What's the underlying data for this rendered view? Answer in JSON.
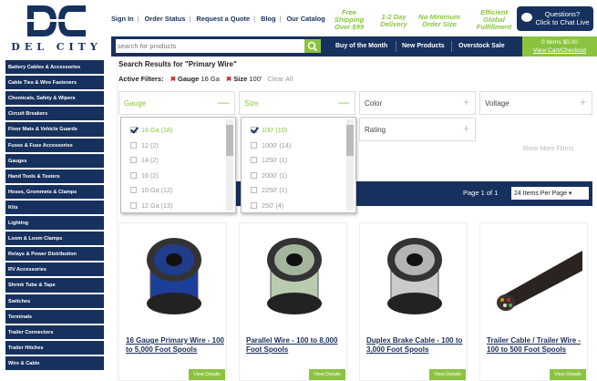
{
  "logo": {
    "word": "DEL CITY"
  },
  "top_links": [
    "Sign In",
    "Order Status",
    "Request a Quote",
    "Blog",
    "Our Catalog"
  ],
  "promos": [
    {
      "l1": "Free",
      "l2": "Shipping",
      "l3": "Over $99"
    },
    {
      "l1": "1-2 Day",
      "l2": "Delivery",
      "l3": ""
    },
    {
      "l1": "No Minimum",
      "l2": "Order Size",
      "l3": ""
    },
    {
      "l1": "Efficient",
      "l2": "Global",
      "l3": "Fulfillment"
    }
  ],
  "chat": {
    "l1": "Questions?",
    "l2": "Click to Chat Live"
  },
  "search": {
    "placeholder": "search for products"
  },
  "nav": [
    "Buy of the Month",
    "New Products",
    "Overstock Sale"
  ],
  "cart": {
    "l1": "0 Items    $0.00",
    "l2": "View Cart/Checkout"
  },
  "sidebar": [
    "Battery Cables & Accessories",
    "Cable Ties & Wire Fasteners",
    "Chemicals, Safety & Wipers",
    "Circuit Breakers",
    "Floor Mats & Vehicle Guards",
    "Fuses & Fuse Accessories",
    "Gauges",
    "Hand Tools & Testers",
    "Hoses, Grommets & Clamps",
    "Kits",
    "Lighting",
    "Loom & Loom Clamps",
    "Relays & Power Distribution",
    "RV Accessories",
    "Shrink Tube & Tape",
    "Switches",
    "Terminals",
    "Trailer Connectors",
    "Trailer Hitches",
    "Wire & Cable"
  ],
  "results": {
    "title": "Search Results for \"Primary Wire\"",
    "active_label": "Active Filters:",
    "f1_name": "Gauge",
    "f1_val": "16 Ga",
    "f2_name": "Size",
    "f2_val": "100'",
    "clear": "Clear All"
  },
  "filters": [
    {
      "label": "Gauge",
      "sign": "—"
    },
    {
      "label": "Size",
      "sign": "—"
    },
    {
      "label": "Color",
      "sign": "+"
    },
    {
      "label": "Voltage",
      "sign": "+"
    },
    {
      "label": "Rating",
      "sign": "+"
    }
  ],
  "gauge_opts": [
    {
      "t": "16 Ga (18)",
      "on": true
    },
    {
      "t": "12 (2)",
      "on": false
    },
    {
      "t": "14 (2)",
      "on": false
    },
    {
      "t": "16 (2)",
      "on": false
    },
    {
      "t": "10 Ga (12)",
      "on": false
    },
    {
      "t": "12 Ga (13)",
      "on": false
    }
  ],
  "size_opts": [
    {
      "t": "100' (10)",
      "on": true
    },
    {
      "t": "1000' (14)",
      "on": false
    },
    {
      "t": "1250' (1)",
      "on": false
    },
    {
      "t": "2000' (1)",
      "on": false
    },
    {
      "t": "2250' (1)",
      "on": false
    },
    {
      "t": "250' (4)",
      "on": false
    }
  ],
  "show_more": "Show More Filters",
  "pager": {
    "page": "Page 1 of 1",
    "per_page": "24 Items Per Page ▾"
  },
  "products": [
    {
      "name": "16 Gauge Primary Wire - 100 to 5,000 Foot Spools",
      "btn": "View Details",
      "color": "#1d3f9c"
    },
    {
      "name": "Parallel Wire - 100 to 8,000 Foot Spools",
      "btn": "View Details",
      "color": "#b9ccb0"
    },
    {
      "name": "Duplex Brake Cable - 100 to 3,000 Foot Spools",
      "btn": "View Details",
      "color": "#c9cbcd"
    },
    {
      "name": "Trailer Cable / Trailer Wire - 100 to 500 Foot Spools",
      "btn": "View Details",
      "color": "#222"
    }
  ]
}
